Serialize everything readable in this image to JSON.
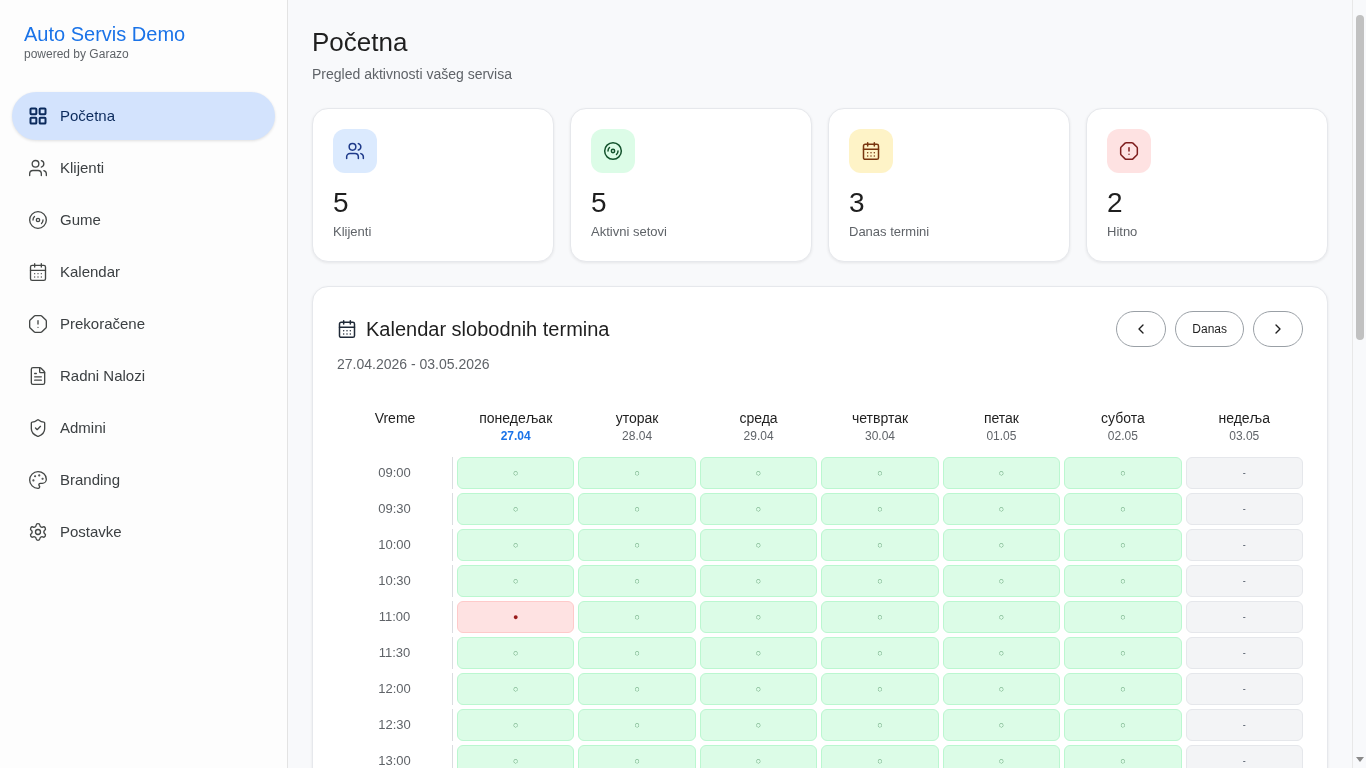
{
  "sidebar": {
    "brand": "Auto Servis Demo",
    "tagline": "powered by Garazo",
    "items": [
      {
        "label": "Početna",
        "selected": true
      },
      {
        "label": "Klijenti",
        "selected": false
      },
      {
        "label": "Gume",
        "selected": false
      },
      {
        "label": "Kalendar",
        "selected": false
      },
      {
        "label": "Prekoračene",
        "selected": false
      },
      {
        "label": "Radni Nalozi",
        "selected": false
      },
      {
        "label": "Admini",
        "selected": false
      },
      {
        "label": "Branding",
        "selected": false
      },
      {
        "label": "Postavke",
        "selected": false
      }
    ]
  },
  "page": {
    "title": "Početna",
    "subtitle": "Pregled aktivnosti vašeg servisa"
  },
  "stats": [
    {
      "kind": "clients",
      "value": "5",
      "label": "Klijenti"
    },
    {
      "kind": "tire_sets",
      "value": "5",
      "label": "Aktivni setovi"
    },
    {
      "kind": "appointments",
      "value": "3",
      "label": "Danas termini"
    },
    {
      "kind": "urgent",
      "value": "2",
      "label": "Hitno"
    }
  ],
  "calendar": {
    "title": "Kalendar slobodnih termina",
    "range": "27.04.2026 - 03.05.2026",
    "today_button": "Danas",
    "time_header": "Vreme",
    "days": [
      {
        "name": "понедељак",
        "date": "27.04",
        "today": true
      },
      {
        "name": "уторак",
        "date": "28.04",
        "today": false
      },
      {
        "name": "среда",
        "date": "29.04",
        "today": false
      },
      {
        "name": "четвртак",
        "date": "30.04",
        "today": false
      },
      {
        "name": "петак",
        "date": "01.05",
        "today": false
      },
      {
        "name": "субота",
        "date": "02.05",
        "today": false
      },
      {
        "name": "недеља",
        "date": "03.05",
        "today": false
      }
    ],
    "rows": [
      {
        "time": "09:00",
        "slots": [
          {
            "kind": "free",
            "symbol": "○"
          },
          {
            "kind": "free",
            "symbol": "○"
          },
          {
            "kind": "free",
            "symbol": "○"
          },
          {
            "kind": "free",
            "symbol": "○"
          },
          {
            "kind": "free",
            "symbol": "○"
          },
          {
            "kind": "free",
            "symbol": "○"
          },
          {
            "kind": "closed",
            "symbol": "-"
          }
        ]
      },
      {
        "time": "09:30",
        "slots": [
          {
            "kind": "free",
            "symbol": "○"
          },
          {
            "kind": "free",
            "symbol": "○"
          },
          {
            "kind": "free",
            "symbol": "○"
          },
          {
            "kind": "free",
            "symbol": "○"
          },
          {
            "kind": "free",
            "symbol": "○"
          },
          {
            "kind": "free",
            "symbol": "○"
          },
          {
            "kind": "closed",
            "symbol": "-"
          }
        ]
      },
      {
        "time": "10:00",
        "slots": [
          {
            "kind": "free",
            "symbol": "○"
          },
          {
            "kind": "free",
            "symbol": "○"
          },
          {
            "kind": "free",
            "symbol": "○"
          },
          {
            "kind": "free",
            "symbol": "○"
          },
          {
            "kind": "free",
            "symbol": "○"
          },
          {
            "kind": "free",
            "symbol": "○"
          },
          {
            "kind": "closed",
            "symbol": "-"
          }
        ]
      },
      {
        "time": "10:30",
        "slots": [
          {
            "kind": "free",
            "symbol": "○"
          },
          {
            "kind": "free",
            "symbol": "○"
          },
          {
            "kind": "free",
            "symbol": "○"
          },
          {
            "kind": "free",
            "symbol": "○"
          },
          {
            "kind": "free",
            "symbol": "○"
          },
          {
            "kind": "free",
            "symbol": "○"
          },
          {
            "kind": "closed",
            "symbol": "-"
          }
        ]
      },
      {
        "time": "11:00",
        "slots": [
          {
            "kind": "busy",
            "symbol": "●"
          },
          {
            "kind": "free",
            "symbol": "○"
          },
          {
            "kind": "free",
            "symbol": "○"
          },
          {
            "kind": "free",
            "symbol": "○"
          },
          {
            "kind": "free",
            "symbol": "○"
          },
          {
            "kind": "free",
            "symbol": "○"
          },
          {
            "kind": "closed",
            "symbol": "-"
          }
        ]
      },
      {
        "time": "11:30",
        "slots": [
          {
            "kind": "free",
            "symbol": "○"
          },
          {
            "kind": "free",
            "symbol": "○"
          },
          {
            "kind": "free",
            "symbol": "○"
          },
          {
            "kind": "free",
            "symbol": "○"
          },
          {
            "kind": "free",
            "symbol": "○"
          },
          {
            "kind": "free",
            "symbol": "○"
          },
          {
            "kind": "closed",
            "symbol": "-"
          }
        ]
      },
      {
        "time": "12:00",
        "slots": [
          {
            "kind": "free",
            "symbol": "○"
          },
          {
            "kind": "free",
            "symbol": "○"
          },
          {
            "kind": "free",
            "symbol": "○"
          },
          {
            "kind": "free",
            "symbol": "○"
          },
          {
            "kind": "free",
            "symbol": "○"
          },
          {
            "kind": "free",
            "symbol": "○"
          },
          {
            "kind": "closed",
            "symbol": "-"
          }
        ]
      },
      {
        "time": "12:30",
        "slots": [
          {
            "kind": "free",
            "symbol": "○"
          },
          {
            "kind": "free",
            "symbol": "○"
          },
          {
            "kind": "free",
            "symbol": "○"
          },
          {
            "kind": "free",
            "symbol": "○"
          },
          {
            "kind": "free",
            "symbol": "○"
          },
          {
            "kind": "free",
            "symbol": "○"
          },
          {
            "kind": "closed",
            "symbol": "-"
          }
        ]
      },
      {
        "time": "13:00",
        "slots": [
          {
            "kind": "free",
            "symbol": "○"
          },
          {
            "kind": "free",
            "symbol": "○"
          },
          {
            "kind": "free",
            "symbol": "○"
          },
          {
            "kind": "free",
            "symbol": "○"
          },
          {
            "kind": "free",
            "symbol": "○"
          },
          {
            "kind": "free",
            "symbol": "○"
          },
          {
            "kind": "closed",
            "symbol": "-"
          }
        ]
      }
    ]
  }
}
